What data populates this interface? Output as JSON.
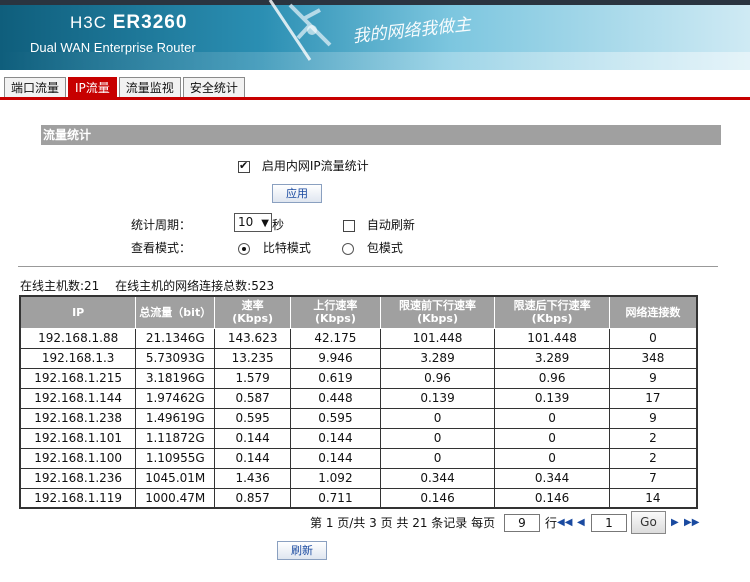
{
  "header": {
    "brand_prefix": "H3C",
    "brand_model": "ER3260",
    "subtitle": "Dual WAN Enterprise Router",
    "slogan": "我的网络我做主"
  },
  "tabs": [
    {
      "label": "端口流量",
      "active": false
    },
    {
      "label": "IP流量",
      "active": true
    },
    {
      "label": "流量监视",
      "active": false
    },
    {
      "label": "安全统计",
      "active": false
    }
  ],
  "section_title": "流量统计",
  "enable_ip_stats": {
    "label": "启用内网IP流量统计",
    "checked": true
  },
  "apply_label": "应用",
  "period": {
    "label": "统计周期：",
    "value": "10",
    "unit": "秒"
  },
  "auto_refresh": {
    "label": "自动刷新",
    "checked": false
  },
  "view_mode": {
    "label": "查看模式：",
    "options": [
      {
        "label": "比特模式",
        "selected": true
      },
      {
        "label": "包模式",
        "selected": false
      }
    ]
  },
  "summary": {
    "hosts_label": "在线主机数:21",
    "connections_label": "在线主机的网络连接总数:523"
  },
  "table": {
    "headers": [
      "IP",
      "总流量（bit）",
      "速率\n(Kbps)",
      "上行速率\n(Kbps)",
      "限速前下行速率\n(Kbps)",
      "限速后下行速率\n(Kbps)",
      "网络连接数"
    ],
    "rows": [
      [
        "192.168.1.88",
        "21.1346G",
        "143.623",
        "42.175",
        "101.448",
        "101.448",
        "0"
      ],
      [
        "192.168.1.3",
        "5.73093G",
        "13.235",
        "9.946",
        "3.289",
        "3.289",
        "348"
      ],
      [
        "192.168.1.215",
        "3.18196G",
        "1.579",
        "0.619",
        "0.96",
        "0.96",
        "9"
      ],
      [
        "192.168.1.144",
        "1.97462G",
        "0.587",
        "0.448",
        "0.139",
        "0.139",
        "17"
      ],
      [
        "192.168.1.238",
        "1.49619G",
        "0.595",
        "0.595",
        "0",
        "0",
        "9"
      ],
      [
        "192.168.1.101",
        "1.11872G",
        "0.144",
        "0.144",
        "0",
        "0",
        "2"
      ],
      [
        "192.168.1.100",
        "1.10955G",
        "0.144",
        "0.144",
        "0",
        "0",
        "2"
      ],
      [
        "192.168.1.236",
        "1045.01M",
        "1.436",
        "1.092",
        "0.344",
        "0.344",
        "7"
      ],
      [
        "192.168.1.119",
        "1000.47M",
        "0.857",
        "0.711",
        "0.146",
        "0.146",
        "14"
      ]
    ]
  },
  "pager": {
    "info": "第 1 页/共 3 页 共 21 条记录 每页",
    "per_page": "9",
    "rows_unit": "行",
    "page_input": "1",
    "go_label": "Go",
    "icons": [
      "first-page-icon",
      "prev-page-icon",
      "next-page-icon",
      "last-page-icon"
    ]
  },
  "refresh_label": "刷新",
  "colors": {
    "accent_red": "#c70000",
    "header_gray": "#a0a0a0",
    "banner_blue": "#2b8fb3"
  }
}
